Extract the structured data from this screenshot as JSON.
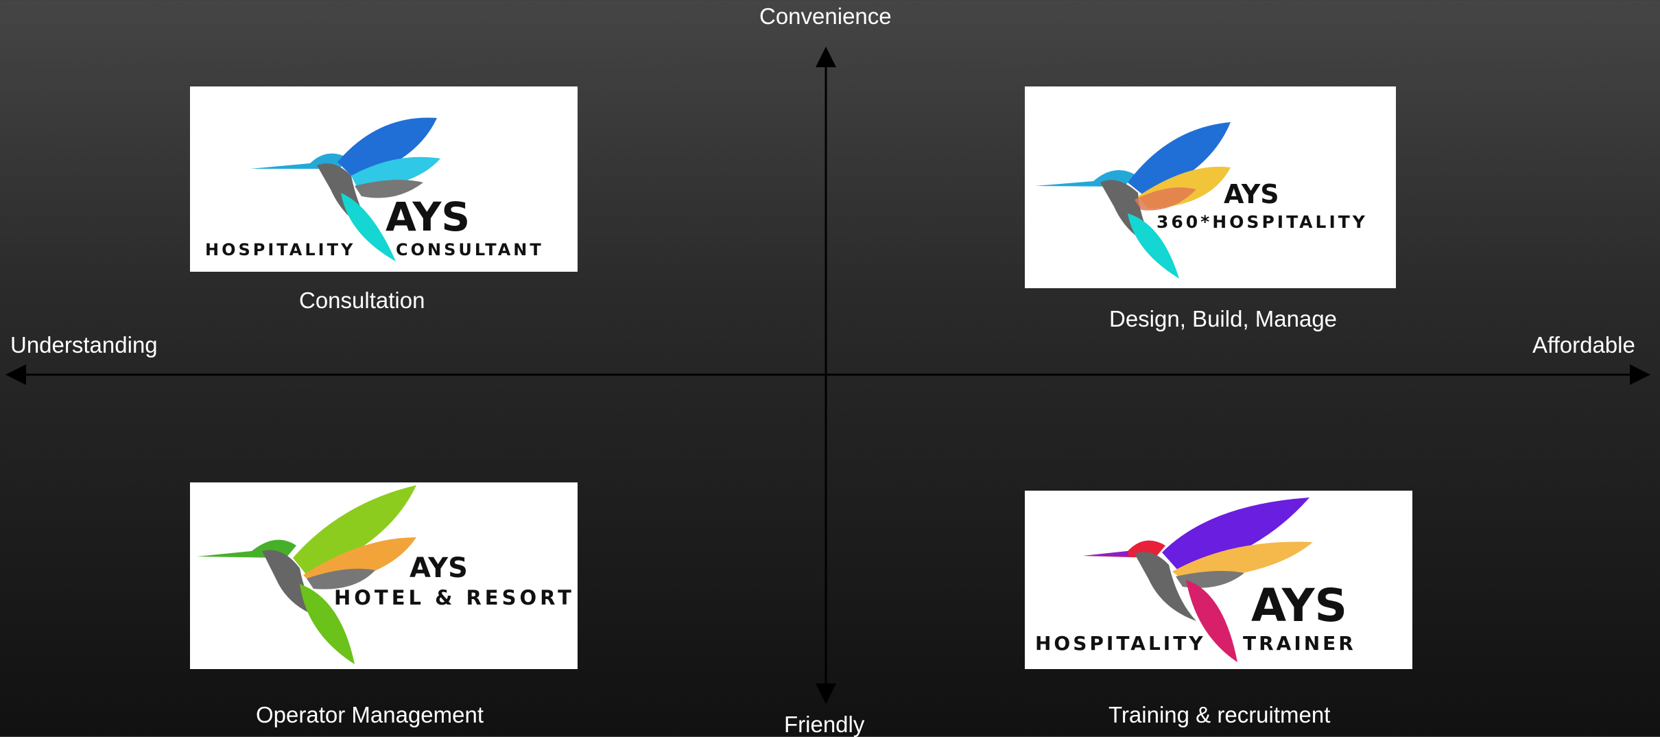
{
  "axes": {
    "top": "Convenience",
    "bottom": "Friendly",
    "left": "Understanding",
    "right": "Affordable"
  },
  "quadrants": [
    {
      "caption": "Consultation",
      "brand": "AYS",
      "subtitle_left": "HOSPITALITY",
      "subtitle_right": "CONSULTANT",
      "colors": {
        "wing1": "#1f6fd6",
        "wing2": "#2fc8e6",
        "tail": "#14d6d2",
        "head": "#23a8d8",
        "body": "#666666"
      }
    },
    {
      "caption": "Design, Build, Manage",
      "brand": "AYS",
      "subtitle": "360*HOSPITALITY",
      "colors": {
        "wing1": "#1f6fd6",
        "wing2": "#f2c43a",
        "tail": "#14d6d2",
        "head": "#23a8d8",
        "body": "#666666",
        "accent": "#e27a52"
      }
    },
    {
      "caption": "Operator Management",
      "brand": "AYS",
      "subtitle": "HOTEL & RESORT",
      "colors": {
        "wing1": "#8ccc1e",
        "wing2": "#f2a43a",
        "tail": "#6ac21a",
        "head": "#47b02a",
        "body": "#666666",
        "accent": "#e27a52"
      }
    },
    {
      "caption": "Training & recruitment",
      "brand": "AYS",
      "subtitle_left": "HOSPITALITY",
      "subtitle_right": "TRAINER",
      "colors": {
        "wing1": "#6a1ee0",
        "wing2": "#f5b84a",
        "tail": "#d8206a",
        "head": "#e8203a",
        "body": "#666666",
        "beak": "#8a20c8"
      }
    }
  ]
}
